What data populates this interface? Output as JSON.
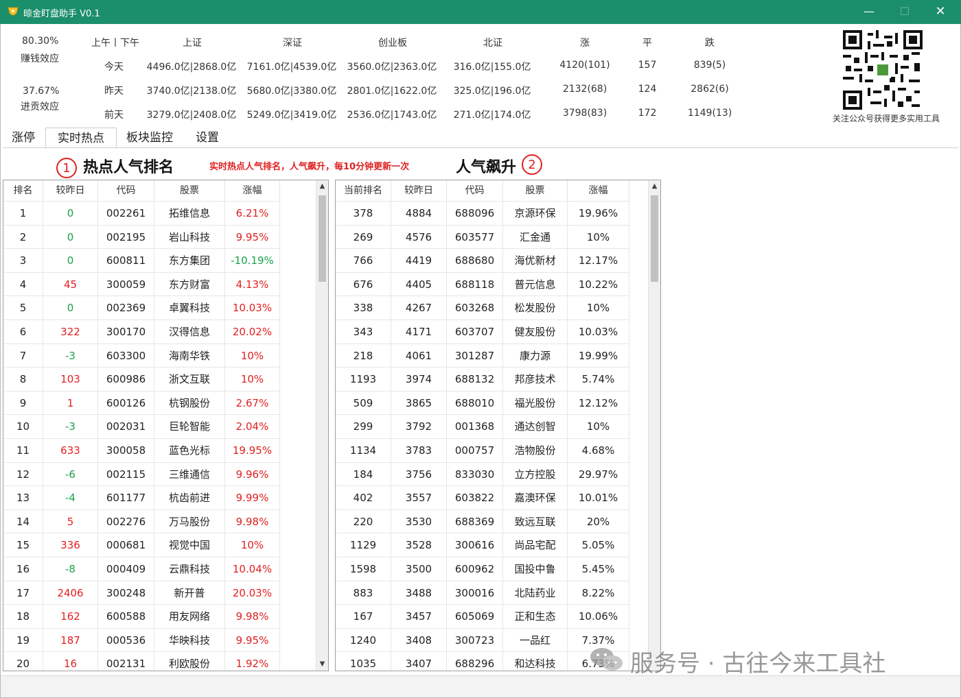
{
  "window": {
    "title": "晾金盯盘助手 V0.1",
    "min": "—",
    "max": "☐",
    "close": "✕"
  },
  "market": {
    "money_effect_pct": "80.30%",
    "money_effect_label": "赚钱效应",
    "limit_effect_pct": "37.67%",
    "limit_effect_label": "进贡效应",
    "headers": [
      "上午丨下午",
      "上证",
      "深证",
      "创业板",
      "北证",
      "涨",
      "平",
      "跌"
    ],
    "rows": [
      {
        "label": "今天",
        "sh": "4496.0亿|2868.0亿",
        "sz": "7161.0亿|4539.0亿",
        "cyb": "3560.0亿|2363.0亿",
        "bz": "316.0亿|155.0亿",
        "up": "4120(101)",
        "flat": "157",
        "down": "839(5)"
      },
      {
        "label": "昨天",
        "sh": "3740.0亿|2138.0亿",
        "sz": "5680.0亿|3380.0亿",
        "cyb": "2801.0亿|1622.0亿",
        "bz": "325.0亿|196.0亿",
        "up": "2132(68)",
        "flat": "124",
        "down": "2862(6)"
      },
      {
        "label": "前天",
        "sh": "3279.0亿|2408.0亿",
        "sz": "5249.0亿|3419.0亿",
        "cyb": "2536.0亿|1743.0亿",
        "bz": "271.0亿|174.0亿",
        "up": "3798(83)",
        "flat": "172",
        "down": "1149(13)"
      }
    ]
  },
  "qr": {
    "caption": "关注公众号获得更多实用工具"
  },
  "tabs": [
    "涨停",
    "实时热点",
    "板块监控",
    "设置"
  ],
  "active_tab": 1,
  "section_left": {
    "num": "1",
    "title": "热点人气排名"
  },
  "section_right": {
    "num": "2",
    "title": "人气飙升"
  },
  "notice": "实时热点人气排名，人气飙升，每10分钟更新一次",
  "left_table": {
    "columns": [
      "排名",
      "较昨日",
      "代码",
      "股票",
      "涨幅"
    ],
    "rows": [
      [
        "1",
        "0",
        "002261",
        "拓维信息",
        "6.21%"
      ],
      [
        "2",
        "0",
        "002195",
        "岩山科技",
        "9.95%"
      ],
      [
        "3",
        "0",
        "600811",
        "东方集团",
        "-10.19%"
      ],
      [
        "4",
        "45",
        "300059",
        "东方财富",
        "4.13%"
      ],
      [
        "5",
        "0",
        "002369",
        "卓翼科技",
        "10.03%"
      ],
      [
        "6",
        "322",
        "300170",
        "汉得信息",
        "20.02%"
      ],
      [
        "7",
        "-3",
        "603300",
        "海南华铁",
        "10%"
      ],
      [
        "8",
        "103",
        "600986",
        "浙文互联",
        "10%"
      ],
      [
        "9",
        "1",
        "600126",
        "杭钢股份",
        "2.67%"
      ],
      [
        "10",
        "-3",
        "002031",
        "巨轮智能",
        "2.04%"
      ],
      [
        "11",
        "633",
        "300058",
        "蓝色光标",
        "19.95%"
      ],
      [
        "12",
        "-6",
        "002115",
        "三维通信",
        "9.96%"
      ],
      [
        "13",
        "-4",
        "601177",
        "杭齿前进",
        "9.99%"
      ],
      [
        "14",
        "5",
        "002276",
        "万马股份",
        "9.98%"
      ],
      [
        "15",
        "336",
        "000681",
        "视觉中国",
        "10%"
      ],
      [
        "16",
        "-8",
        "000409",
        "云鼎科技",
        "10.04%"
      ],
      [
        "17",
        "2406",
        "300248",
        "新开普",
        "20.03%"
      ],
      [
        "18",
        "162",
        "600588",
        "用友网络",
        "9.98%"
      ],
      [
        "19",
        "187",
        "000536",
        "华映科技",
        "9.95%"
      ],
      [
        "20",
        "16",
        "002131",
        "利欧股份",
        "1.92%"
      ]
    ]
  },
  "right_table": {
    "columns": [
      "当前排名",
      "较昨日",
      "代码",
      "股票",
      "涨幅"
    ],
    "rows": [
      [
        "378",
        "4884",
        "688096",
        "京源环保",
        "19.96%"
      ],
      [
        "269",
        "4576",
        "603577",
        "汇金通",
        "10%"
      ],
      [
        "766",
        "4419",
        "688680",
        "海优新材",
        "12.17%"
      ],
      [
        "676",
        "4405",
        "688118",
        "普元信息",
        "10.22%"
      ],
      [
        "338",
        "4267",
        "603268",
        "松发股份",
        "10%"
      ],
      [
        "343",
        "4171",
        "603707",
        "健友股份",
        "10.03%"
      ],
      [
        "218",
        "4061",
        "301287",
        "康力源",
        "19.99%"
      ],
      [
        "1193",
        "3974",
        "688132",
        "邦彦技术",
        "5.74%"
      ],
      [
        "509",
        "3865",
        "688010",
        "福光股份",
        "12.12%"
      ],
      [
        "299",
        "3792",
        "001368",
        "通达创智",
        "10%"
      ],
      [
        "1134",
        "3783",
        "000757",
        "浩物股份",
        "4.68%"
      ],
      [
        "184",
        "3756",
        "833030",
        "立方控股",
        "29.97%"
      ],
      [
        "402",
        "3557",
        "603822",
        "嘉澳环保",
        "10.01%"
      ],
      [
        "220",
        "3530",
        "688369",
        "致远互联",
        "20%"
      ],
      [
        "1129",
        "3528",
        "300616",
        "尚品宅配",
        "5.05%"
      ],
      [
        "1598",
        "3500",
        "600962",
        "国投中鲁",
        "5.45%"
      ],
      [
        "883",
        "3488",
        "300016",
        "北陆药业",
        "8.22%"
      ],
      [
        "167",
        "3457",
        "605069",
        "正和生态",
        "10.06%"
      ],
      [
        "1240",
        "3408",
        "300723",
        "一品红",
        "7.37%"
      ],
      [
        "1035",
        "3407",
        "688296",
        "和达科技",
        "6.73%"
      ]
    ]
  },
  "watermark": "服务号 · 古往今来工具社",
  "colors": {
    "titlebar": "#1b8f6a",
    "up": "#e02020",
    "down": "#18a04a"
  }
}
